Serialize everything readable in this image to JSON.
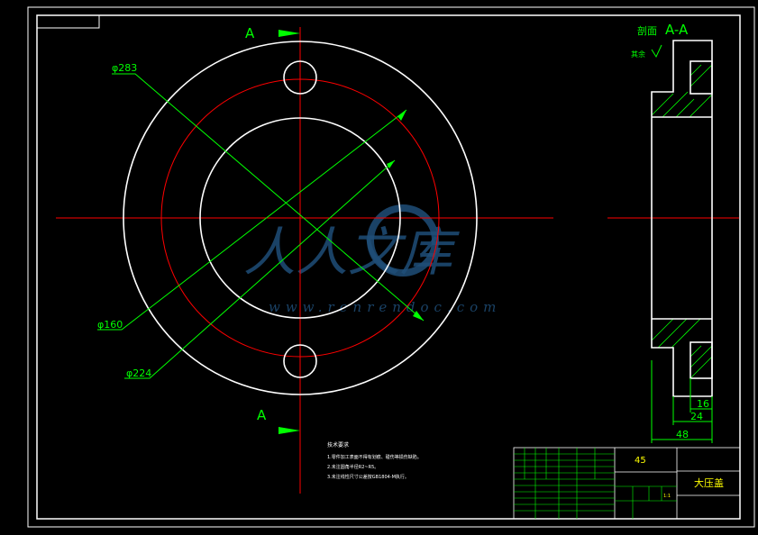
{
  "section_marks": {
    "top": "A",
    "bottom": "A"
  },
  "dimensions": {
    "d283": "φ283",
    "d160": "φ160",
    "d224": "φ224",
    "w48": "48",
    "w24": "24",
    "w16": "16"
  },
  "section_view": {
    "title": "A-A",
    "title_prefix": "剖面",
    "roughness_note": "其余"
  },
  "notes": {
    "heading": "技术要求",
    "items": [
      "1.零件加工表面不得有划痕、碰伤等损伤缺陷。",
      "2.未注圆角半径R2~R5。",
      "3.未注线性尺寸公差按GB1804-M执行。"
    ]
  },
  "title_block": {
    "material": "45",
    "part_name": "大压盖",
    "scale": "1:1"
  },
  "watermark": {
    "text": "人人文库",
    "url": "www.renrendoc.com"
  },
  "colors": {
    "line": "#ffffff",
    "dim": "#00ff00",
    "center": "#ff0000",
    "text": "#ffff00"
  }
}
